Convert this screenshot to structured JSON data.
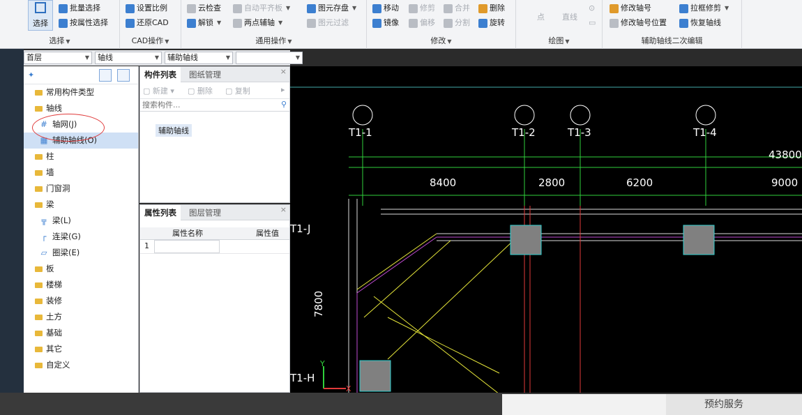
{
  "ribbon": {
    "select_group": {
      "big_select": "选择",
      "batch_select": "批量选择",
      "attr_select": "按属性选择",
      "title": "选择"
    },
    "cad_group": {
      "set_scale": "设置比例",
      "restore_cad": "还原CAD",
      "title": "CAD操作"
    },
    "general_group": {
      "cloud_check": "云检查",
      "auto_align": "自动平齐板",
      "save_element": "图元存盘",
      "unlock": "解锁",
      "two_point_aux": "两点辅轴",
      "element_filter": "图元过滤",
      "title": "通用操作"
    },
    "modify_group": {
      "move": "移动",
      "trim": "修剪",
      "merge": "合并",
      "delete": "删除",
      "mirror": "镜像",
      "offset": "偏移",
      "split": "分割",
      "rotate": "旋转",
      "title": "修改"
    },
    "draw_group": {
      "point": "点",
      "line": "直线",
      "title": "绘图"
    },
    "aux_group": {
      "modify_axis_no": "修改轴号",
      "box_trim": "拉框修剪",
      "modify_axis_pos": "修改轴号位置",
      "restore_axis": "恢复轴线",
      "title": "辅助轴线二次编辑"
    }
  },
  "selectors": {
    "floor": "首层",
    "category": "轴线",
    "type": "辅助轴线",
    "extra": ""
  },
  "tree": {
    "items": [
      {
        "label": "常用构件类型",
        "kind": "folder"
      },
      {
        "label": "轴线",
        "kind": "folder"
      },
      {
        "label": "轴网(J)",
        "kind": "sub",
        "icon": "#"
      },
      {
        "label": "辅助轴线(O)",
        "kind": "sub",
        "icon": "▦"
      },
      {
        "label": "柱",
        "kind": "folder"
      },
      {
        "label": "墙",
        "kind": "folder"
      },
      {
        "label": "门窗洞",
        "kind": "folder"
      },
      {
        "label": "梁",
        "kind": "folder"
      },
      {
        "label": "梁(L)",
        "kind": "sub",
        "icon": "╦"
      },
      {
        "label": "连梁(G)",
        "kind": "sub",
        "icon": "┌"
      },
      {
        "label": "圈梁(E)",
        "kind": "sub",
        "icon": "▱"
      },
      {
        "label": "板",
        "kind": "folder"
      },
      {
        "label": "楼梯",
        "kind": "folder"
      },
      {
        "label": "装修",
        "kind": "folder"
      },
      {
        "label": "土方",
        "kind": "folder"
      },
      {
        "label": "基础",
        "kind": "folder"
      },
      {
        "label": "其它",
        "kind": "folder"
      },
      {
        "label": "自定义",
        "kind": "folder"
      }
    ]
  },
  "component_panel": {
    "tab_list": "构件列表",
    "tab_drawing": "图纸管理",
    "new": "新建",
    "delete": "删除",
    "copy": "复制",
    "search_placeholder": "搜索构件...",
    "item": "辅助轴线"
  },
  "property_panel": {
    "tab_attr": "属性列表",
    "tab_layer": "图层管理",
    "col_name": "属性名称",
    "col_value": "属性值",
    "row1": "1"
  },
  "cad": {
    "axes": [
      "T1-1",
      "T1-2",
      "T1-3",
      "T1-4"
    ],
    "row_axes": [
      "T1-J",
      "T1-H"
    ],
    "dims_top": [
      "8400",
      "2800",
      "6200",
      "9000"
    ],
    "total_dim": "43800",
    "left_dim": "7800"
  },
  "footer": {
    "service": "预约服务"
  }
}
